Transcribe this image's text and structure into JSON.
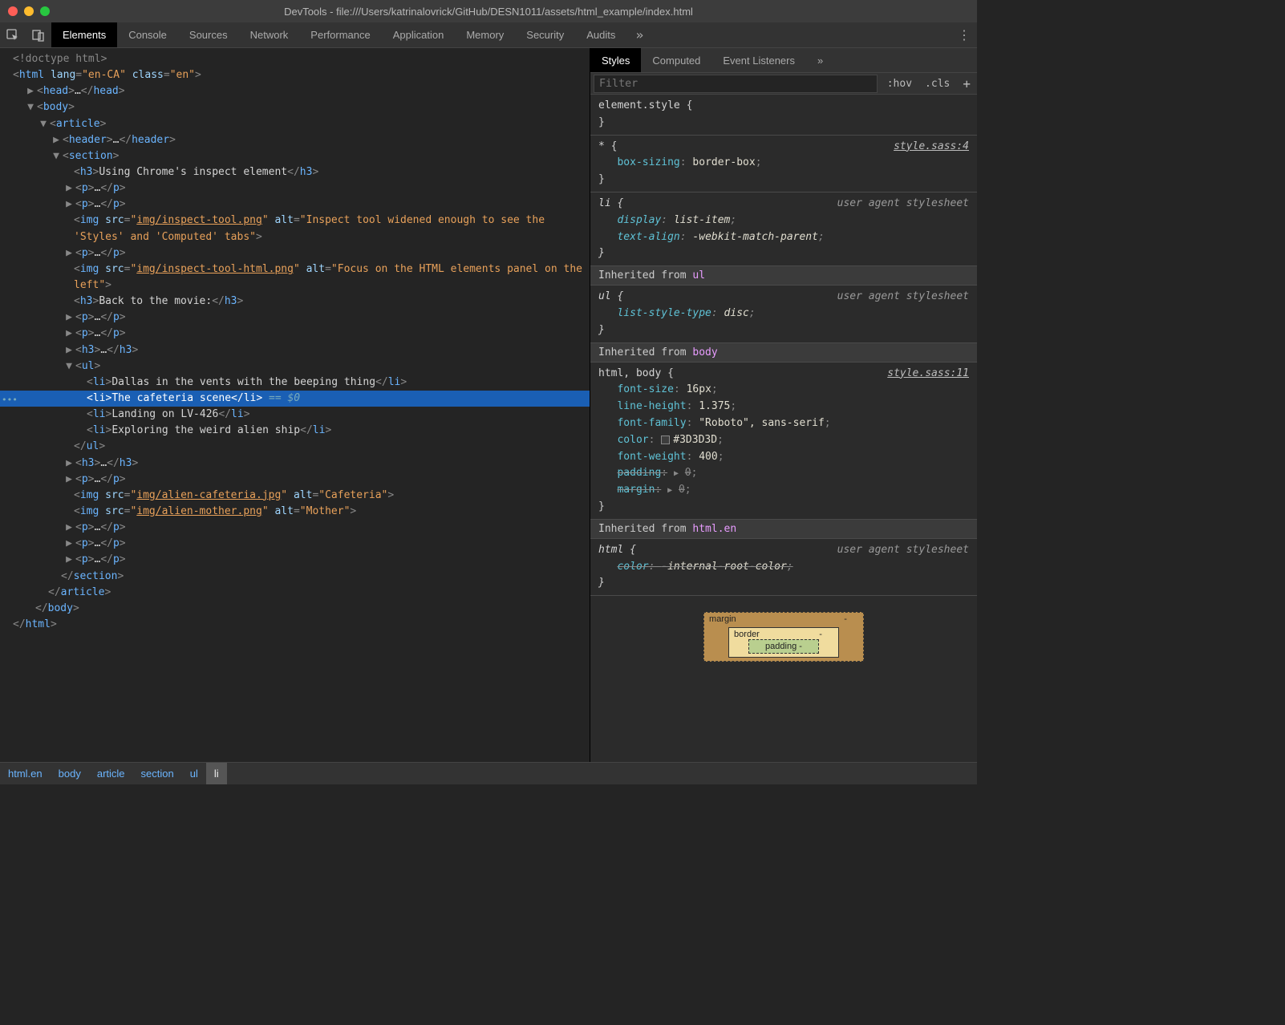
{
  "window": {
    "title": "DevTools - file:///Users/katrinalovrick/GitHub/DESN1011/assets/html_example/index.html"
  },
  "toolbar_tabs": [
    "Elements",
    "Console",
    "Sources",
    "Network",
    "Performance",
    "Application",
    "Memory",
    "Security",
    "Audits"
  ],
  "right_tabs": [
    "Styles",
    "Computed",
    "Event Listeners"
  ],
  "filter": {
    "placeholder": "Filter",
    "hov": ":hov",
    "cls": ".cls"
  },
  "breadcrumbs": [
    "html.en",
    "body",
    "article",
    "section",
    "ul",
    "li"
  ],
  "elements": {
    "doctype": "<!doctype html>",
    "html_open": {
      "tag": "html",
      "attrs": "lang=\"en-CA\" class=\"en\""
    },
    "head": {
      "tag": "head",
      "ell": "…"
    },
    "body_open": {
      "tag": "body"
    },
    "article_open": {
      "tag": "article"
    },
    "header": {
      "tag": "header",
      "ell": "…"
    },
    "section_open": {
      "tag": "section"
    },
    "h3_1": {
      "text": "Using Chrome's inspect element"
    },
    "p_ell": "…",
    "img1": {
      "src": "img/inspect-tool.png",
      "alt": "Inspect tool widened enough to see the 'Styles' and 'Computed' tabs"
    },
    "img2": {
      "src": "img/inspect-tool-html.png",
      "alt": "Focus on the HTML elements panel on the left"
    },
    "h3_2": {
      "text": "Back to the movie:"
    },
    "li1": "Dallas in the vents with the beeping thing",
    "li2": "The cafeteria scene",
    "li3": "Landing on LV-426",
    "li4": "Exploring the weird alien ship",
    "img3": {
      "src": "img/alien-cafeteria.jpg",
      "alt": "Cafeteria"
    },
    "img4": {
      "src": "img/alien-mother.png",
      "alt": "Mother"
    },
    "eq0": "== $0"
  },
  "styles": {
    "element_style": {
      "sel": "element.style",
      "body": ""
    },
    "star": {
      "sel": "*",
      "link": "style.sass:4",
      "props": [
        {
          "name": "box-sizing",
          "value": "border-box"
        }
      ]
    },
    "li": {
      "sel": "li",
      "ua": "user agent stylesheet",
      "props": [
        {
          "name": "display",
          "value": "list-item"
        },
        {
          "name": "text-align",
          "value": "-webkit-match-parent"
        }
      ]
    },
    "inherit1": {
      "label": "Inherited from ",
      "from": "ul"
    },
    "ul": {
      "sel": "ul",
      "ua": "user agent stylesheet",
      "props": [
        {
          "name": "list-style-type",
          "value": "disc"
        }
      ]
    },
    "inherit2": {
      "label": "Inherited from ",
      "from": "body"
    },
    "htmlbody": {
      "sel": "html, body",
      "link": "style.sass:11",
      "props": [
        {
          "name": "font-size",
          "value": "16px"
        },
        {
          "name": "line-height",
          "value": "1.375"
        },
        {
          "name": "font-family",
          "value": "\"Roboto\", sans-serif"
        },
        {
          "name": "color",
          "value": "#3D3D3D",
          "swatch": true
        },
        {
          "name": "font-weight",
          "value": "400"
        },
        {
          "name": "padding",
          "value": "0",
          "collapsed": true,
          "struck": true
        },
        {
          "name": "margin",
          "value": "0",
          "collapsed": true,
          "struck": true
        }
      ]
    },
    "inherit3": {
      "label": "Inherited from ",
      "from": "html.en"
    },
    "html": {
      "sel": "html",
      "ua": "user agent stylesheet",
      "props": [
        {
          "name": "color",
          "value": "-internal-root-color",
          "struck": true
        }
      ]
    }
  },
  "boxmodel": {
    "margin": "margin",
    "border": "border",
    "padding": "padding",
    "dash": "-"
  }
}
